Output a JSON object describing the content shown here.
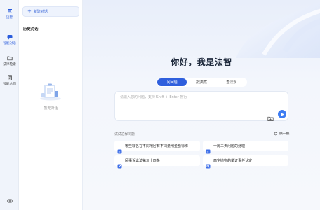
{
  "rail": {
    "items": [
      {
        "label": "迈智",
        "icon": "menu-icon"
      },
      {
        "label": "智能对话",
        "icon": "chat-icon"
      },
      {
        "label": "法律检索",
        "icon": "folder-icon"
      },
      {
        "label": "智能合同",
        "icon": "contract-icon"
      }
    ],
    "bottom_icon": "link-icon"
  },
  "history": {
    "new_chat_label": "新建对话",
    "title": "历史对话",
    "empty_text": "暂无对话"
  },
  "main": {
    "greeting": "你好，我是法智",
    "tabs": [
      {
        "label": "问问题",
        "active": true
      },
      {
        "label": "找类案",
        "active": false
      },
      {
        "label": "查法规",
        "active": false
      }
    ],
    "input_placeholder": "请输入您的问题，支持 Shift + Enter 换行",
    "recommend_title": "试试这样问题",
    "refresh_label": "换一换",
    "suggestions": [
      "哪些罪名在不同地区有不同量刑金额标准",
      "一房二卖问题的处理",
      "民事诉讼法第三十四条",
      "高空抛物的举证责任认定"
    ]
  },
  "colors": {
    "accent": "#2f5fdd",
    "send": "#3d7cf2",
    "background": "#f4f7fc"
  }
}
